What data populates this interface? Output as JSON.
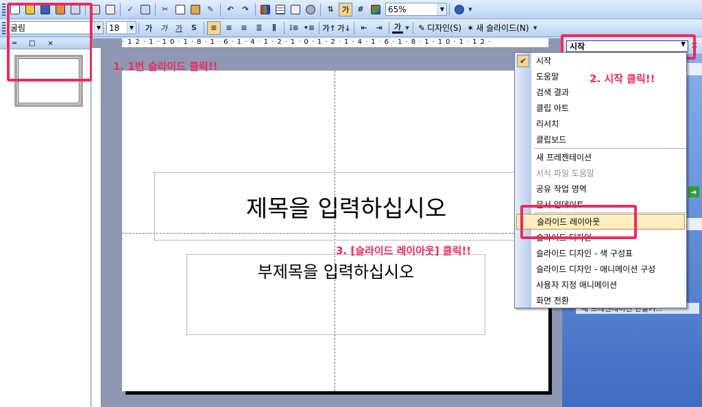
{
  "toolbar": {
    "zoom": "65%",
    "font_name": "굴림",
    "font_size": "18",
    "font_color_label": "가",
    "design_button": "디자인(S)",
    "new_slide_button": "새 슬라이드(N)"
  },
  "task_pane": {
    "selected": "시작",
    "close": "×",
    "link_text": "새 프레젠테이션 만들기..."
  },
  "dropdown": {
    "items": [
      "시작",
      "도움말",
      "검색 결과",
      "클립 아트",
      "리서치",
      "클립보드",
      "새 프레젠테이션",
      "서식 파일 도움말",
      "공유 작업 영역",
      "문서 업데이트",
      "슬라이드 레이아웃",
      "슬라이드 디자인",
      "슬라이드 디자인 - 색 구성표",
      "슬라이드 디자인 - 애니메이션 구성",
      "사용자 지정 애니메이션",
      "화면 전환"
    ],
    "disabled_index": 7,
    "highlighted_index": 10,
    "checked_index": 0
  },
  "ruler": {
    "horizontal": "·12·1·10·1·8·1·6·1·4·1·2·1·0·1·2·1·4·1·6·1·8·1·10·1·12·"
  },
  "slide": {
    "title_placeholder": "제목을 입력하십시오",
    "subtitle_placeholder": "부제목을 입력하십시오"
  },
  "annotations": {
    "step1": "1. 1번 슬라이드 클릭!!",
    "step2": "2. 시작 클릭!!",
    "step3": "3. [슬라이드 레이아웃] 클릭!!"
  },
  "icons": [
    "new-icon",
    "open-icon",
    "save-icon",
    "permission-icon",
    "email-icon",
    "print-icon",
    "preview-icon",
    "spelling-icon",
    "research-icon",
    "cut-icon",
    "copy-icon",
    "paste-icon",
    "format-painter-icon",
    "undo-icon",
    "redo-icon",
    "chart-icon",
    "table-icon",
    "tables-borders-icon",
    "hyperlink-icon",
    "expand-icon",
    "grid-icon",
    "color-icon",
    "help-icon"
  ],
  "colors": {
    "annotation": "#ee2a5c",
    "highlight": "#ffeec2"
  }
}
